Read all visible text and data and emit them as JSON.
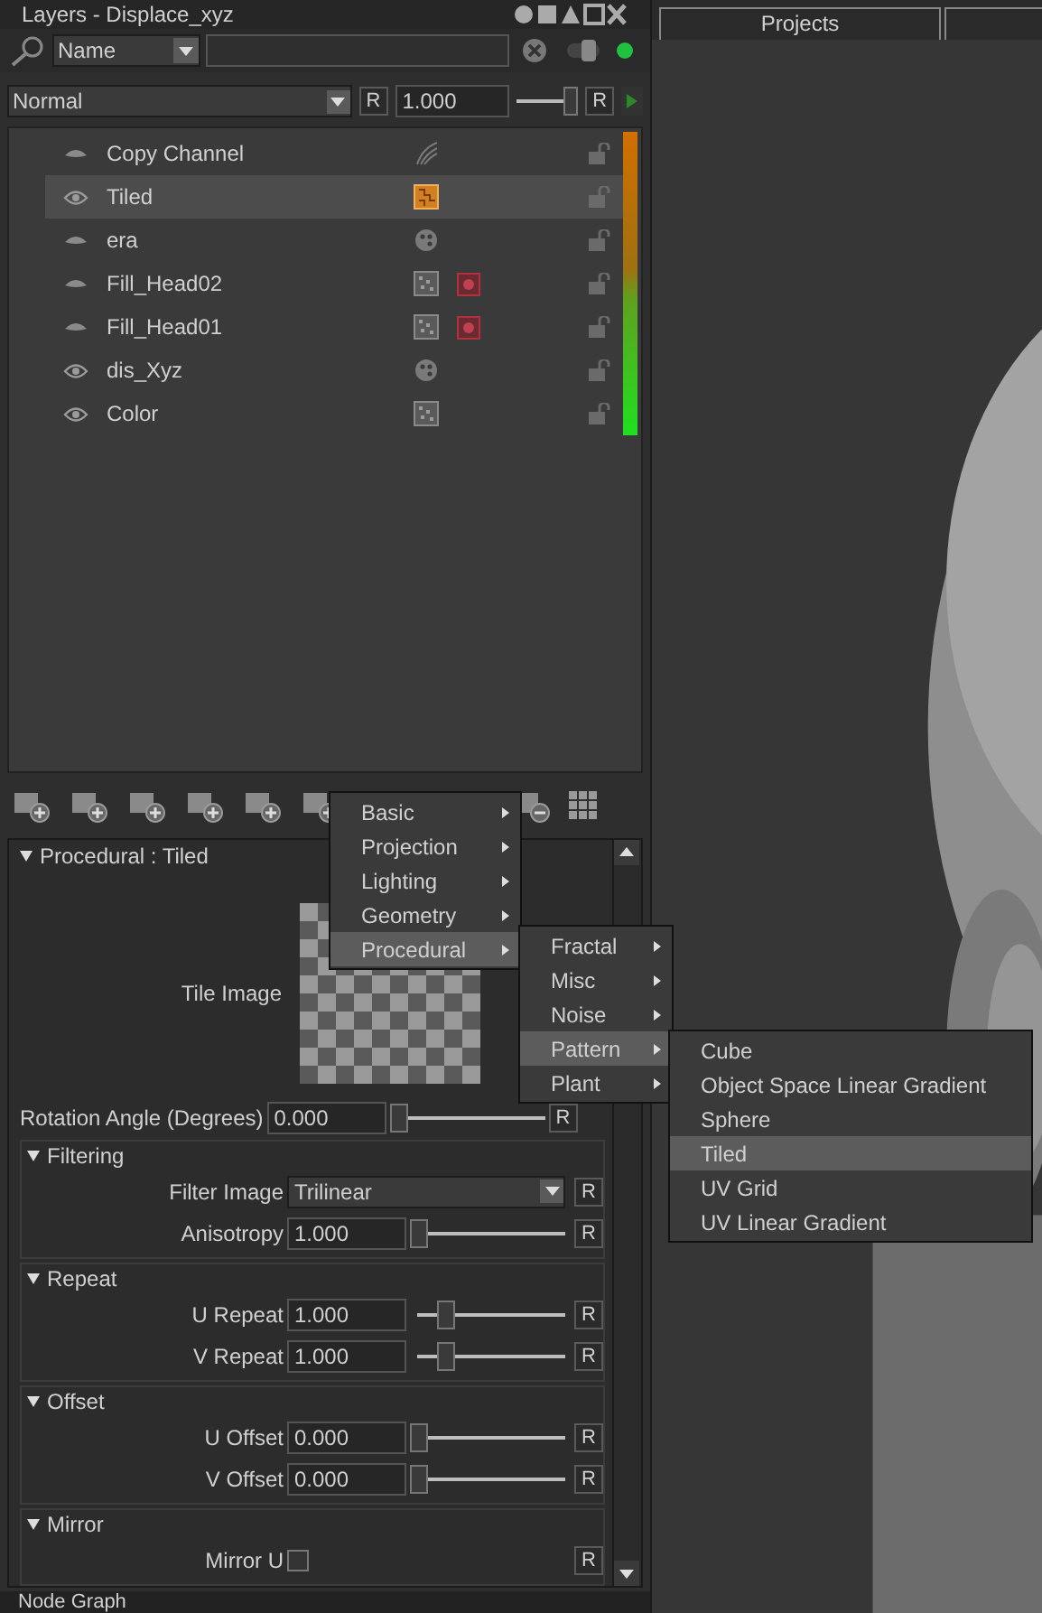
{
  "panel": {
    "title": "Layers - Displace_xyz",
    "filter": "Name",
    "blend_mode": "Normal",
    "blend_reset": "R",
    "opacity": "1.000",
    "level": 1,
    "opacity_reset": "R"
  },
  "layers": [
    {
      "name": "Copy Channel",
      "visible": false,
      "selected": false,
      "kind": "channel",
      "mask": false
    },
    {
      "name": "Tiled",
      "visible": true,
      "selected": true,
      "kind": "tiled",
      "mask": false
    },
    {
      "name": "era",
      "visible": false,
      "selected": false,
      "kind": "paint",
      "mask": false
    },
    {
      "name": "Fill_Head02",
      "visible": false,
      "selected": false,
      "kind": "fill",
      "mask": true
    },
    {
      "name": "Fill_Head01",
      "visible": false,
      "selected": false,
      "kind": "fill",
      "mask": true
    },
    {
      "name": "dis_Xyz",
      "visible": true,
      "selected": false,
      "kind": "paint",
      "mask": false
    },
    {
      "name": "Color",
      "visible": true,
      "selected": false,
      "kind": "fill",
      "mask": false
    }
  ],
  "properties": {
    "header": "Procedural : Tiled",
    "expanded": true,
    "tile_label": "Tile Image",
    "rotation": {
      "label": "Rotation Angle (Degrees)",
      "value": "0.000",
      "level": 0,
      "reset": "R"
    },
    "groups": [
      {
        "title": "Filtering",
        "expanded": true,
        "rows": [
          {
            "kind": "dropdown",
            "label": "Filter Image",
            "value": "Trilinear",
            "reset": "R"
          },
          {
            "kind": "slider",
            "label": "Anisotropy",
            "value": "1.000",
            "level": 0,
            "reset": "R"
          }
        ]
      },
      {
        "title": "Repeat",
        "expanded": true,
        "rows": [
          {
            "kind": "slider",
            "label": "U Repeat",
            "value": "1.000",
            "level": 0.2,
            "reset": "R"
          },
          {
            "kind": "slider",
            "label": "V Repeat",
            "value": "1.000",
            "level": 0.2,
            "reset": "R"
          }
        ]
      },
      {
        "title": "Offset",
        "expanded": true,
        "rows": [
          {
            "kind": "slider",
            "label": "U Offset",
            "value": "0.000",
            "level": 0,
            "reset": "R"
          },
          {
            "kind": "slider",
            "label": "V Offset",
            "value": "0.000",
            "level": 0,
            "reset": "R"
          }
        ]
      },
      {
        "title": "Mirror",
        "expanded": true,
        "rows": [
          {
            "kind": "checkbox",
            "label": "Mirror U",
            "checked": false,
            "reset": "R"
          }
        ]
      }
    ]
  },
  "menus": [
    {
      "items": [
        {
          "label": "Basic",
          "selected": false,
          "submenu": true
        },
        {
          "label": "Projection",
          "selected": false,
          "submenu": true
        },
        {
          "label": "Lighting",
          "selected": false,
          "submenu": true
        },
        {
          "label": "Geometry",
          "selected": false,
          "submenu": true
        },
        {
          "label": "Procedural",
          "selected": true,
          "submenu": true
        }
      ]
    },
    {
      "items": [
        {
          "label": "Fractal",
          "selected": false,
          "submenu": true
        },
        {
          "label": "Misc",
          "selected": false,
          "submenu": true
        },
        {
          "label": "Noise",
          "selected": false,
          "submenu": true
        },
        {
          "label": "Pattern",
          "selected": true,
          "submenu": true
        },
        {
          "label": "Plant",
          "selected": false,
          "submenu": true
        }
      ]
    },
    {
      "items": [
        {
          "label": "Cube",
          "selected": false,
          "submenu": false
        },
        {
          "label": "Object Space Linear Gradient",
          "selected": false,
          "submenu": false
        },
        {
          "label": "Sphere",
          "selected": false,
          "submenu": false
        },
        {
          "label": "Tiled",
          "selected": true,
          "submenu": false
        },
        {
          "label": "UV Grid",
          "selected": false,
          "submenu": false
        },
        {
          "label": "UV Linear Gradient",
          "selected": false,
          "submenu": false
        }
      ]
    }
  ],
  "viewport": {
    "tab": "Projects"
  },
  "bottom_panel": "Node Graph"
}
